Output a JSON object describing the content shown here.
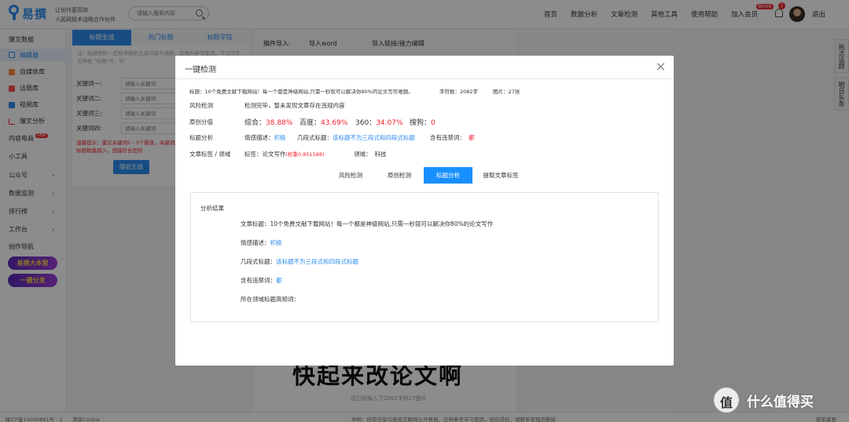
{
  "header": {
    "logo": "易撰",
    "slogan_line1": "让创作更高效",
    "slogan_line2": "人民网技术战略合作伙伴",
    "search_placeholder": "请输入搜索内容",
    "nav": [
      "首页",
      "数据分析",
      "文章检测",
      "其他工具",
      "使用帮助",
      "加入会员"
    ],
    "vip_tag": "限时9折",
    "notify_count": "2",
    "logout": "退出"
  },
  "sidebar": {
    "items": [
      {
        "label": "爆文数据",
        "active": false
      },
      {
        "label": "编辑器",
        "active": true
      },
      {
        "label": "自媒体库",
        "active": false
      },
      {
        "label": "话题库",
        "active": false
      },
      {
        "label": "视频库",
        "active": false
      },
      {
        "label": "爆文分析",
        "active": false
      },
      {
        "label": "内容电商",
        "active": false
      },
      {
        "label": "小工具",
        "active": false
      },
      {
        "label": "公众号",
        "active": false
      },
      {
        "label": "数据监测",
        "active": false
      },
      {
        "label": "排行榜",
        "active": false
      },
      {
        "label": "工作台",
        "active": false
      },
      {
        "label": "创作导航",
        "active": false
      }
    ],
    "new_badge": "NEW",
    "promo1": "易撰大本营",
    "promo2": "一键分发"
  },
  "left_panel": {
    "tabs": [
      "标题生成",
      "热门标题",
      "标题学院"
    ],
    "note": "注：标题按照一定规律随机生成可能不通顺，仅做为参考使用。不过可不五种推 \"标题\"号，好",
    "keyword_rows": [
      {
        "label": "关键词一:",
        "placeholder": "请输入关键词"
      },
      {
        "label": "关键词二:",
        "placeholder": "请输入关键词"
      },
      {
        "label": "关键词三:",
        "placeholder": "请输入关键词"
      },
      {
        "label": "关键词四:",
        "placeholder": "请输入关键词"
      }
    ],
    "generate_button": "随机生成",
    "warm_tip": "温馨提示：建议关键词2 - 3个最佳，关键词越多则生成标题数量越少。但越符合您的"
  },
  "editor": {
    "import_label": "稿件导入:",
    "import_word": "导入word",
    "import_link": "导入链接/接力编辑",
    "big_text": "快起来改论文啊",
    "count_text": "您已经输入了2082字符27图片"
  },
  "right_tabs": [
    "热点话题",
    "明日头条"
  ],
  "footer": {
    "icp": "湘ICP备14006861号 - 3",
    "clear_cookie": "清除Cookie",
    "statement": "声明：所有信息均来自互联网公开数据，仅供参考学习使用，如有侵权，请联系管理员删除",
    "contact": "联系客服"
  },
  "watermark": "什么值得买",
  "modal": {
    "title": "一键检测",
    "article_title_label": "标题：",
    "article_title": "10个免费文献下载网站！每一个都是神级网站,只需一秒就可以解决你80%的论文写作难题。",
    "word_count": "字符数：2082字",
    "image_count": "图片：27张",
    "risk_label": "风险检测",
    "risk_value": "检测完毕，暂未发现文章存在违规内容",
    "original_label": "原创分值",
    "scores": [
      {
        "name": "综合：",
        "value": "38.88%"
      },
      {
        "name": "百度：",
        "value": "43.69%"
      },
      {
        "name": "360：",
        "value": "34.07%"
      },
      {
        "name": "搜狗：",
        "value": "0"
      }
    ],
    "title_analysis_label": "标题分析",
    "sentiment_label": "情感描述：",
    "sentiment_value": "积极",
    "segment_label": "几段式标题：",
    "segment_value": "该标题不为三段式和四段式标题",
    "banned_label": "含有违禁词：",
    "banned_value": "都",
    "tags_label": "文章标签 / 领域",
    "tag_prefix": "标签：",
    "tag_value": "论文写作",
    "tag_weight": "(权重0.851588)",
    "domain_label": "领域：",
    "domain_value": "科技",
    "tabs": [
      "风险检测",
      "原创检测",
      "标题分析",
      "提取文章标签"
    ],
    "active_tab": 2,
    "result": {
      "heading": "分析结果",
      "title_label": "文章标题：",
      "title_value": "10个免费文献下载网站！每一个都是神级网站,只需一秒就可以解决你80%的论文写作",
      "sentiment_label": "情感描述：",
      "sentiment_value": "积极",
      "segment_label": "几段式标题：",
      "segment_value": "该标题不为三段式和四段式标题",
      "banned_label": "含有违禁词：",
      "banned_value": "都",
      "hotwords_label": "所在领域标题高频词："
    }
  }
}
